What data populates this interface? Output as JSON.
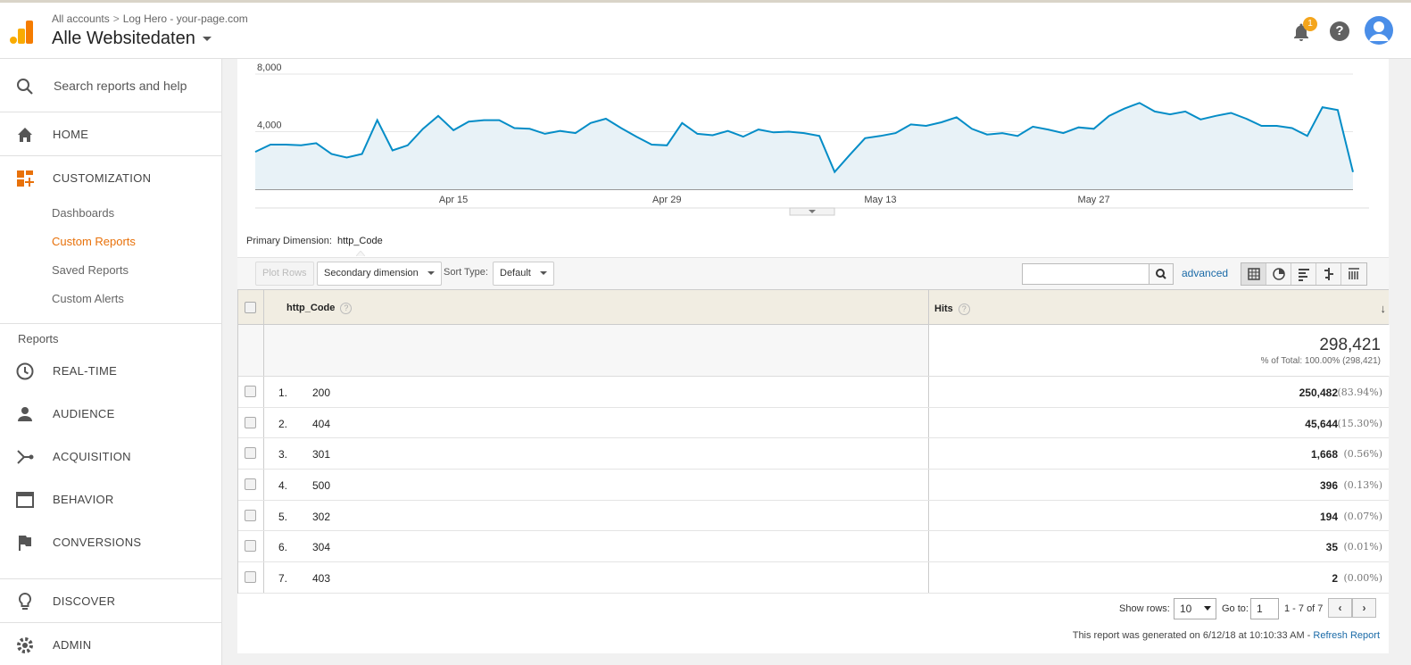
{
  "header": {
    "breadcrumb_account": "All accounts",
    "breadcrumb_property": "Log Hero - your-page.com",
    "view_name": "Alle Websitedaten",
    "notification_count": "1",
    "help_label": "?"
  },
  "sidebar": {
    "search_placeholder": "Search reports and help",
    "home": "HOME",
    "customization": "CUSTOMIZATION",
    "sub_items": [
      "Dashboards",
      "Custom Reports",
      "Saved Reports",
      "Custom Alerts"
    ],
    "reports_section": "Reports",
    "report_items": [
      "REAL-TIME",
      "AUDIENCE",
      "ACQUISITION",
      "BEHAVIOR",
      "CONVERSIONS"
    ],
    "discover": "DISCOVER",
    "admin": "ADMIN"
  },
  "chart_data": {
    "type": "area",
    "y_ticks": [
      "8,000",
      "4,000"
    ],
    "x_ticks": [
      "Apr 15",
      "Apr 29",
      "May 13",
      "May 27"
    ],
    "color": "#058dc7",
    "series": [
      {
        "values": [
          2600,
          3100,
          3100,
          3050,
          3200,
          2450,
          2200,
          2450,
          4800,
          2700,
          3050,
          4200,
          5100,
          4100,
          4700,
          4800,
          4800,
          4250,
          4200,
          3850,
          4050,
          3900,
          4600,
          4900,
          4250,
          3650,
          3100,
          3050,
          4600,
          3850,
          3750,
          4050,
          3650,
          4150,
          3950,
          4000,
          3900,
          3700,
          1200,
          2400,
          3550,
          3700,
          3900,
          4500,
          4400,
          4650,
          5000,
          4200,
          3800,
          3900,
          3700,
          4350,
          4150,
          3900,
          4300,
          4200,
          5100,
          5600,
          6000,
          5400,
          5200,
          5400,
          4850,
          5100,
          5300,
          4900,
          4400,
          4400,
          4250,
          3700,
          5700,
          5500,
          1200
        ]
      }
    ]
  },
  "report": {
    "primary_dimension_label": "Primary Dimension:",
    "primary_dimension_value": "http_Code",
    "plot_rows": "Plot Rows",
    "secondary_dimension": "Secondary dimension",
    "sort_type_label": "Sort Type:",
    "sort_type_value": "Default",
    "advanced": "advanced",
    "col_dimension": "http_Code",
    "col_metric": "Hits",
    "total_value": "298,421",
    "total_sub": "% of Total: 100.00% (298,421)",
    "rows": [
      {
        "idx": "1.",
        "code": "200",
        "hits": "250,482",
        "pct": "(83.94%)"
      },
      {
        "idx": "2.",
        "code": "404",
        "hits": "45,644",
        "pct": "(15.30%)"
      },
      {
        "idx": "3.",
        "code": "301",
        "hits": "1,668",
        "pct": "(0.56%)"
      },
      {
        "idx": "4.",
        "code": "500",
        "hits": "396",
        "pct": "(0.13%)"
      },
      {
        "idx": "5.",
        "code": "302",
        "hits": "194",
        "pct": "(0.07%)"
      },
      {
        "idx": "6.",
        "code": "304",
        "hits": "35",
        "pct": "(0.01%)"
      },
      {
        "idx": "7.",
        "code": "403",
        "hits": "2",
        "pct": "(0.00%)"
      }
    ],
    "show_rows_label": "Show rows:",
    "show_rows_value": "10",
    "goto_label": "Go to:",
    "goto_value": "1",
    "range_text": "1 - 7 of 7",
    "footer_text": "This report was generated on 6/12/18 at 10:10:33 AM -",
    "refresh_link": "Refresh Report"
  }
}
